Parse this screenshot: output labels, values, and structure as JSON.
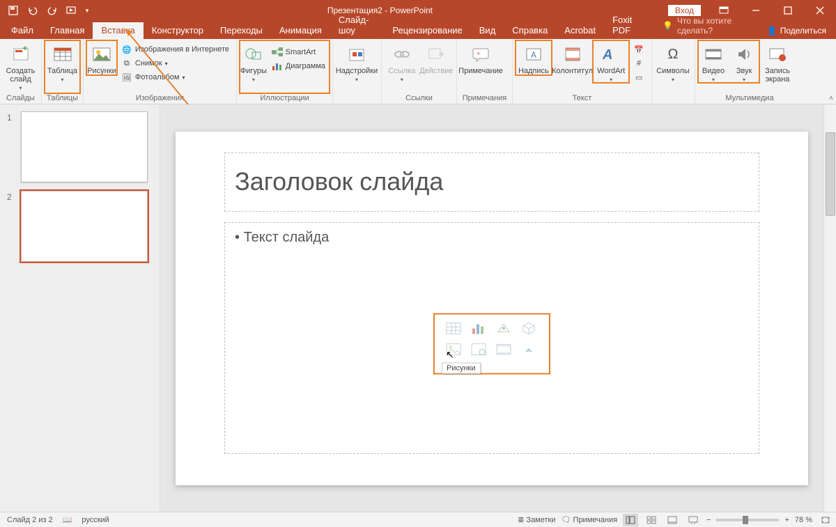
{
  "window": {
    "title": "Презентация2 - PowerPoint",
    "signin": "Вход"
  },
  "tabs": {
    "file": "Файл",
    "home": "Главная",
    "insert": "Вставка",
    "design": "Конструктор",
    "transitions": "Переходы",
    "animations": "Анимация",
    "slideshow": "Слайд-шоу",
    "review": "Рецензирование",
    "view": "Вид",
    "help": "Справка",
    "acrobat": "Acrobat",
    "foxit": "Foxit PDF",
    "tell": "Что вы хотите сделать?",
    "share": "Поделиться"
  },
  "ribbon": {
    "slides": {
      "new_slide": "Создать\nслайд",
      "group": "Слайды"
    },
    "tables": {
      "table": "Таблица",
      "group": "Таблицы"
    },
    "images": {
      "pictures": "Рисунки",
      "online": "Изображения в Интернете",
      "screenshot": "Снимок",
      "album": "Фотоальбом",
      "group": "Изображения"
    },
    "illustrations": {
      "shapes": "Фигуры",
      "smartart": "SmartArt",
      "chart": "Диаграмма",
      "group": "Иллюстрации"
    },
    "addins": {
      "addins": "Надстройки",
      "group": ""
    },
    "links": {
      "hyperlink": "Ссылка",
      "action": "Действие",
      "group": "Ссылки"
    },
    "comments": {
      "comment": "Примечание",
      "group": "Примечания"
    },
    "text": {
      "textbox": "Надпись",
      "header": "Колонтитул",
      "wordart": "WordArt",
      "group": "Текст"
    },
    "symbols": {
      "symbols": "Символы",
      "group": ""
    },
    "media": {
      "video": "Видео",
      "audio": "Звук",
      "screenrec": "Запись\nэкрана",
      "group": "Мультимедиа"
    }
  },
  "thumbs": {
    "s1": "1",
    "s2": "2"
  },
  "slide": {
    "title": "Заголовок слайда",
    "body": "Текст слайда",
    "tooltip": "Рисунки"
  },
  "status": {
    "slide": "Слайд 2 из 2",
    "lang": "русский",
    "notes": "Заметки",
    "comments": "Примечания",
    "zoom": "78 %"
  }
}
